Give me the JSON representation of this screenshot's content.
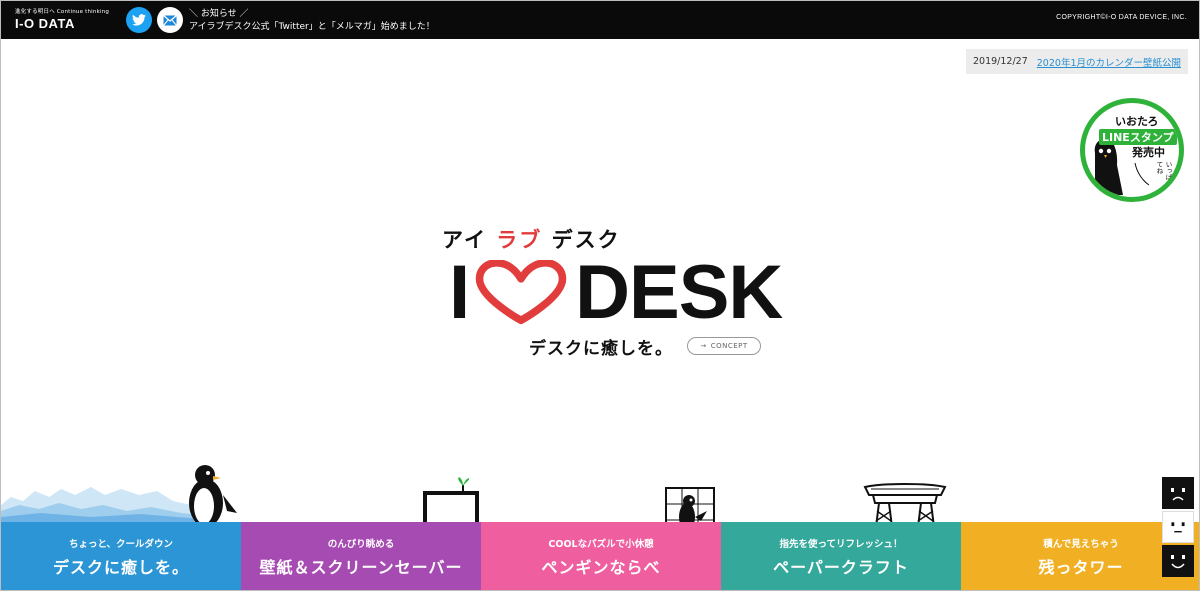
{
  "brand": {
    "tagline": "進化する明日へ Continue thinking",
    "logo": "I-O DATA"
  },
  "social": {
    "twitter_icon": "twitter-bird-icon",
    "mail_icon": "mail-icon"
  },
  "news": {
    "heading": "＼ お知らせ ／",
    "text": "アイラブデスク公式「Twitter」と「メルマガ」始めました！"
  },
  "copyright": "COPYRIGHT©I-O DATA DEVICE, INC.",
  "announcement": {
    "date": "2019/12/27",
    "link": "2020年1月のカレンダー壁紙公開"
  },
  "line_badge": {
    "line1": "いおたろ",
    "line2": "LINEスタンプ",
    "line3": "発売中",
    "bubble": "いっぱい使ってね"
  },
  "hero": {
    "sub_a": "アイ",
    "sub_b": "ラブ",
    "sub_c": "デスク",
    "title_left": "I",
    "title_right": "DESK",
    "tagline": "デスクに癒しを。",
    "concept_button": "CONCEPT"
  },
  "categories": [
    {
      "small": "ちょっと、クールダウン",
      "large": "デスクに癒しを。",
      "color": "#2b95d6"
    },
    {
      "small": "のんびり眺める",
      "large": "壁紙＆スクリーンセーバー",
      "color": "#a64bb1"
    },
    {
      "small": "COOLなパズルで小休憩",
      "large": "ペンギンならべ",
      "color": "#ef5f9f"
    },
    {
      "small": "指先を使ってリフレッシュ！",
      "large": "ペーパークラフト",
      "color": "#33a89b"
    },
    {
      "small": "積んで見えちゃう",
      "large": "残っタワー",
      "color": "#f1af24"
    }
  ],
  "colors": {
    "topbar": "#0a0a0a",
    "accent_red": "#e23d3d",
    "line_green": "#2fb23a",
    "link_blue": "#2a8fd1"
  }
}
